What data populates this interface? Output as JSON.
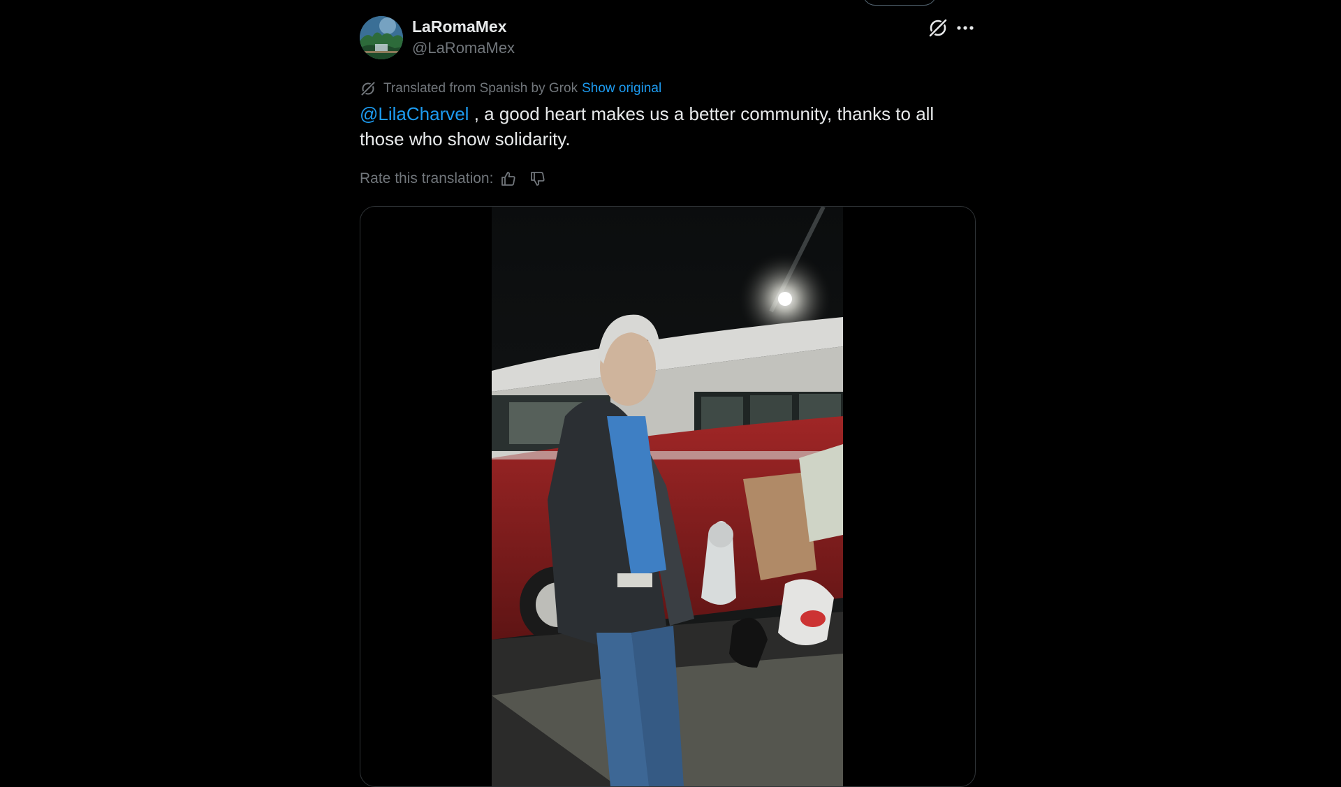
{
  "post": {
    "author": {
      "display_name": "LaRomaMex",
      "handle": "@LaRomaMex"
    },
    "header_icons": [
      "grok-icon",
      "more-options-icon"
    ],
    "translation": {
      "notice": "Translated from Spanish by Grok",
      "show_original_label": "Show original"
    },
    "text": {
      "mention": "@LilaCharvel",
      "body": " , a good heart makes us a better community, thanks to all those who show solidarity."
    },
    "rate": {
      "label": "Rate this translation:",
      "icons": [
        "thumbs-up-icon",
        "thumbs-down-icon"
      ]
    },
    "media": {
      "type": "video"
    }
  },
  "colors": {
    "background": "#000000",
    "primary_text": "#e7e9ea",
    "secondary_text": "#71767b",
    "link": "#1d9bf0",
    "border": "#2f3336"
  }
}
